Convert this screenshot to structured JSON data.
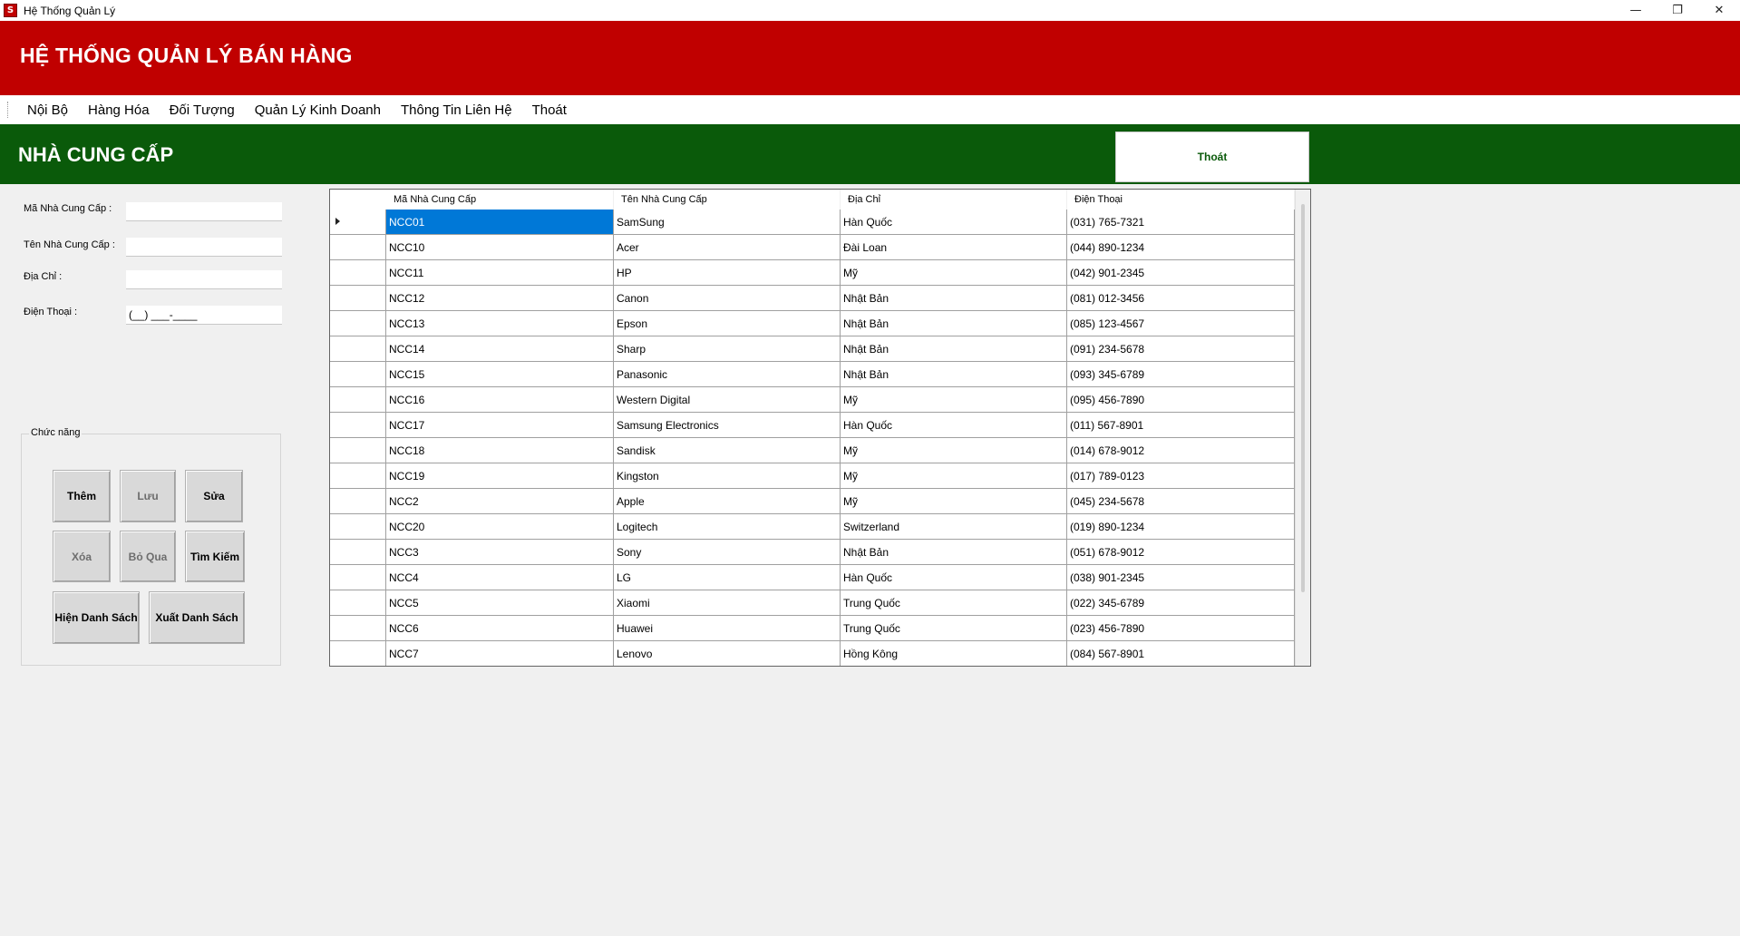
{
  "window": {
    "title": "Hệ Thống Quản Lý",
    "app_icon_letter": "S",
    "controls": {
      "minimize": "—",
      "maximize": "❐",
      "close": "✕"
    }
  },
  "banner": {
    "title": "HỆ THỐNG QUẢN LÝ BÁN HÀNG"
  },
  "menu": {
    "items": [
      "Nội Bộ",
      "Hàng Hóa",
      "Đối Tượng",
      "Quản Lý Kinh Doanh",
      "Thông Tin Liên Hệ",
      "Thoát"
    ]
  },
  "section": {
    "title": "NHÀ CUNG CẤP",
    "exit_label": "Thoát"
  },
  "form": {
    "supplier_id_label": "Mã Nhà Cung Cấp :",
    "supplier_id_value": "",
    "supplier_name_label": "Tên Nhà Cung Cấp :",
    "supplier_name_value": "",
    "address_label": "Địa Chỉ :",
    "address_value": "",
    "phone_label": "Điện Thoại :",
    "phone_value": "(__) ___-____"
  },
  "functions": {
    "group_label": "Chức năng",
    "add": "Thêm",
    "save": "Lưu",
    "edit": "Sửa",
    "delete": "Xóa",
    "skip": "Bỏ Qua",
    "search": "Tìm Kiếm",
    "show_list": "Hiện Danh Sách",
    "export_list": "Xuất Danh Sách"
  },
  "grid": {
    "columns": [
      "Mã Nhà Cung Cấp",
      "Tên Nhà Cung Cấp",
      "Địa Chỉ",
      "Điện Thoại"
    ],
    "rows": [
      [
        "NCC01",
        "SamSung",
        "Hàn Quốc",
        "(031) 765-7321"
      ],
      [
        "NCC10",
        "Acer",
        "Đài Loan",
        "(044) 890-1234"
      ],
      [
        "NCC11",
        "HP",
        "Mỹ",
        "(042) 901-2345"
      ],
      [
        "NCC12",
        "Canon",
        "Nhật Bản",
        "(081) 012-3456"
      ],
      [
        "NCC13",
        "Epson",
        "Nhật Bản",
        "(085) 123-4567"
      ],
      [
        "NCC14",
        "Sharp",
        "Nhật Bản",
        "(091) 234-5678"
      ],
      [
        "NCC15",
        "Panasonic",
        "Nhật Bản",
        "(093) 345-6789"
      ],
      [
        "NCC16",
        "Western Digital",
        "Mỹ",
        "(095) 456-7890"
      ],
      [
        "NCC17",
        "Samsung Electronics",
        "Hàn Quốc",
        "(011) 567-8901"
      ],
      [
        "NCC18",
        "Sandisk",
        "Mỹ",
        "(014) 678-9012"
      ],
      [
        "NCC19",
        "Kingston",
        "Mỹ",
        "(017) 789-0123"
      ],
      [
        "NCC2",
        "Apple",
        "Mỹ",
        "(045) 234-5678"
      ],
      [
        "NCC20",
        "Logitech",
        "Switzerland",
        "(019) 890-1234"
      ],
      [
        "NCC3",
        "Sony",
        "Nhật Bản",
        "(051) 678-9012"
      ],
      [
        "NCC4",
        "LG",
        "Hàn Quốc",
        "(038) 901-2345"
      ],
      [
        "NCC5",
        "Xiaomi",
        "Trung Quốc",
        "(022) 345-6789"
      ],
      [
        "NCC6",
        "Huawei",
        "Trung Quốc",
        "(023) 456-7890"
      ],
      [
        "NCC7",
        "Lenovo",
        "Hồng Kông",
        "(084) 567-8901"
      ]
    ],
    "selected_row": 0,
    "selected_col": 0
  },
  "colors": {
    "banner": "#c00000",
    "section": "#0a5a0a",
    "selection": "#0078d7"
  }
}
